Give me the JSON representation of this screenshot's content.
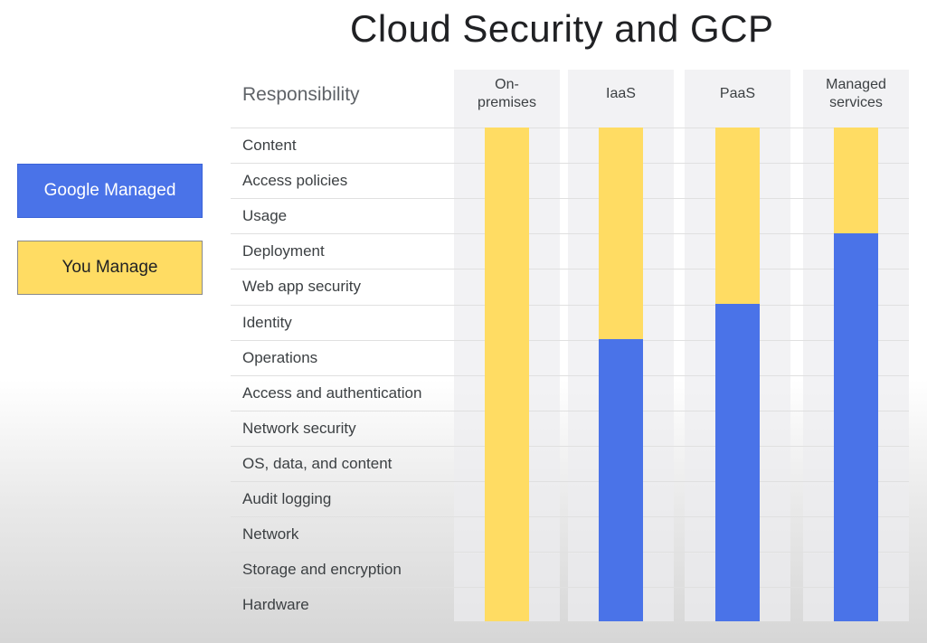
{
  "title": "Cloud Security and GCP",
  "legend": {
    "google_label": "Google Managed",
    "you_label": "You Manage",
    "google_color": "#4a73e8",
    "you_color": "#ffdc63"
  },
  "table": {
    "responsibility_header": "Responsibility",
    "rows": [
      "Content",
      "Access policies",
      "Usage",
      "Deployment",
      "Web app security",
      "Identity",
      "Operations",
      "Access and authentication",
      "Network security",
      "OS, data, and content",
      "Audit logging",
      "Network",
      "Storage and encryption",
      "Hardware"
    ],
    "columns": [
      {
        "label_line1": "On-",
        "label_line2": "premises",
        "you_manage_rows": 14
      },
      {
        "label_line1": "IaaS",
        "label_line2": "",
        "you_manage_rows": 6
      },
      {
        "label_line1": "PaaS",
        "label_line2": "",
        "you_manage_rows": 5
      },
      {
        "label_line1": "Managed",
        "label_line2": "services",
        "you_manage_rows": 3
      }
    ]
  }
}
